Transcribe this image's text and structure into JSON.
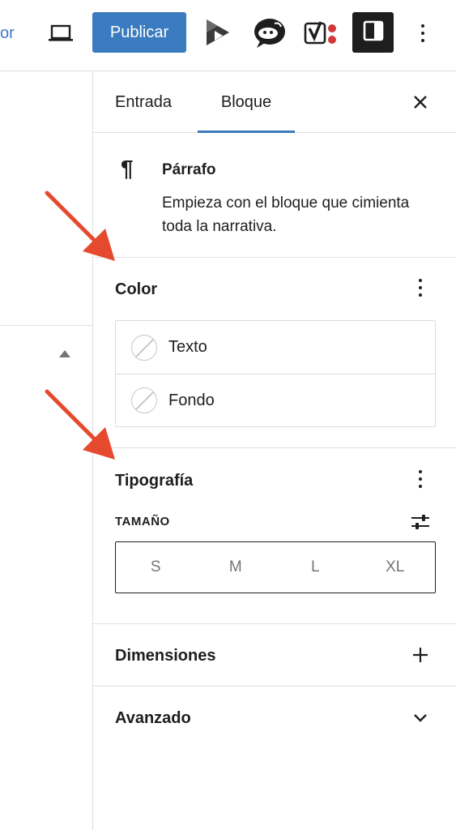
{
  "toolbar": {
    "edge_link": "or",
    "publish_label": "Publicar",
    "icons": [
      "laptop-icon",
      "plugin-play-icon",
      "chat-avatar-icon",
      "yoast-icon",
      "settings-sidebar-icon",
      "more-vertical-icon"
    ]
  },
  "sidebar": {
    "tabs": [
      {
        "label": "Entrada",
        "active": false
      },
      {
        "label": "Bloque",
        "active": true
      }
    ],
    "block": {
      "title": "Párrafo",
      "description": "Empieza con el bloque que cimienta toda la narrativa."
    },
    "color": {
      "title": "Color",
      "items": [
        {
          "label": "Texto"
        },
        {
          "label": "Fondo"
        }
      ]
    },
    "typography": {
      "title": "Tipografía",
      "size_label": "TAMAÑO",
      "sizes": [
        "S",
        "M",
        "L",
        "XL"
      ]
    },
    "dimensions": {
      "title": "Dimensiones"
    },
    "advanced": {
      "title": "Avanzado"
    }
  },
  "colors": {
    "accent": "#3b7bbf",
    "annotation_arrow": "#e64a2e",
    "text": "#1e1e1e",
    "border": "#e0e0e0"
  }
}
